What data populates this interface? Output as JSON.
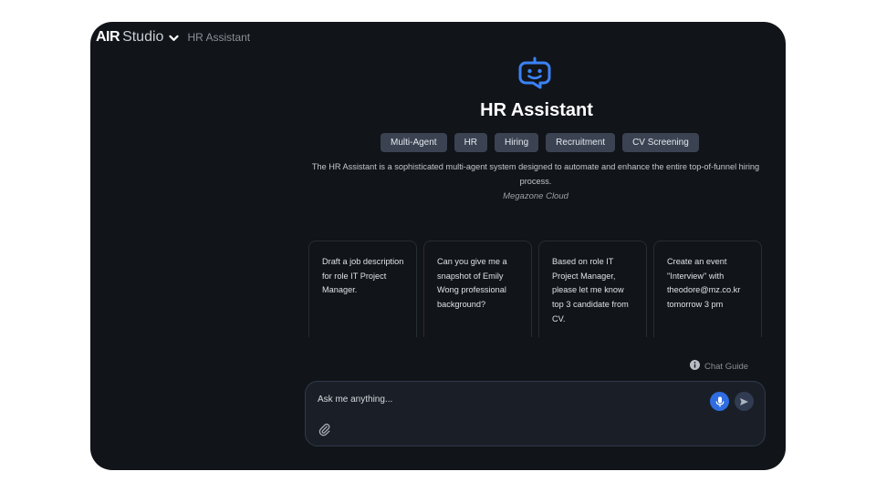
{
  "brand": {
    "logo_text": "AIR",
    "product_name": "Studio",
    "current_page": "HR Assistant"
  },
  "assistant": {
    "icon": "robot-chat-icon",
    "title": "HR Assistant",
    "tags": [
      "Multi-Agent",
      "HR",
      "Hiring",
      "Recruitment",
      "CV Screening"
    ],
    "description": "The HR Assistant is a sophisticated multi-agent system designed to automate and enhance the entire top-of-funnel hiring process.",
    "author": "Megazone Cloud"
  },
  "suggestions": [
    "Draft a job description for role IT Project Manager.",
    "Can you give me a snapshot of Emily Wong professional background?",
    "Based on role IT Project Manager, please let me know top 3 candidate from CV.",
    "Create an event \"Interview\" with theodore@mz.co.kr tomorrow 3 pm"
  ],
  "chat_guide": {
    "icon": "info-icon",
    "label": "Chat Guide"
  },
  "chat": {
    "placeholder": "Ask me anything...",
    "mic_icon": "microphone-icon",
    "send_icon": "send-icon",
    "attach_icon": "paperclip-icon"
  },
  "colors": {
    "background": "#111418",
    "accent": "#2f6de1",
    "bot_icon": "#3b82f6",
    "tag_bg": "#3b4352"
  }
}
